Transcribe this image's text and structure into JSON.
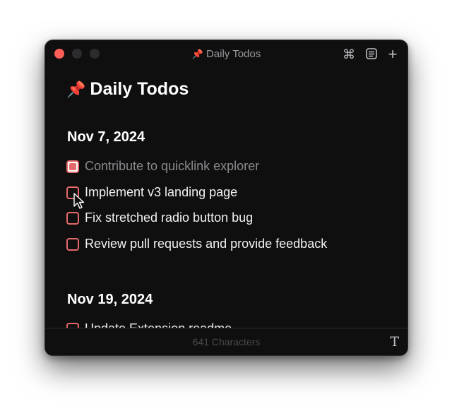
{
  "window": {
    "title": "Daily Todos",
    "title_icon": "pushpin-icon",
    "toolbar": {
      "command_icon": "⌘",
      "notes_icon": "☰",
      "add_icon": "+"
    }
  },
  "document": {
    "heading": "Daily Todos",
    "heading_icon": "📌",
    "sections": [
      {
        "date": "Nov 7, 2024",
        "items": [
          {
            "text": "Contribute to quicklink explorer",
            "checked": true
          },
          {
            "text": "Implement v3 landing page",
            "checked": false
          },
          {
            "text": "Fix stretched radio button bug",
            "checked": false
          },
          {
            "text": "Review pull requests and provide feedback",
            "checked": false
          }
        ]
      },
      {
        "date": "Nov 19, 2024",
        "items": [
          {
            "text": "Update Extension readme",
            "checked": false
          }
        ]
      }
    ]
  },
  "status": {
    "char_count": "641 Characters",
    "format_icon": "T"
  },
  "colors": {
    "window_bg": "#0f0f10",
    "accent_red": "#e66a6a",
    "close_button": "#ff5f57"
  }
}
